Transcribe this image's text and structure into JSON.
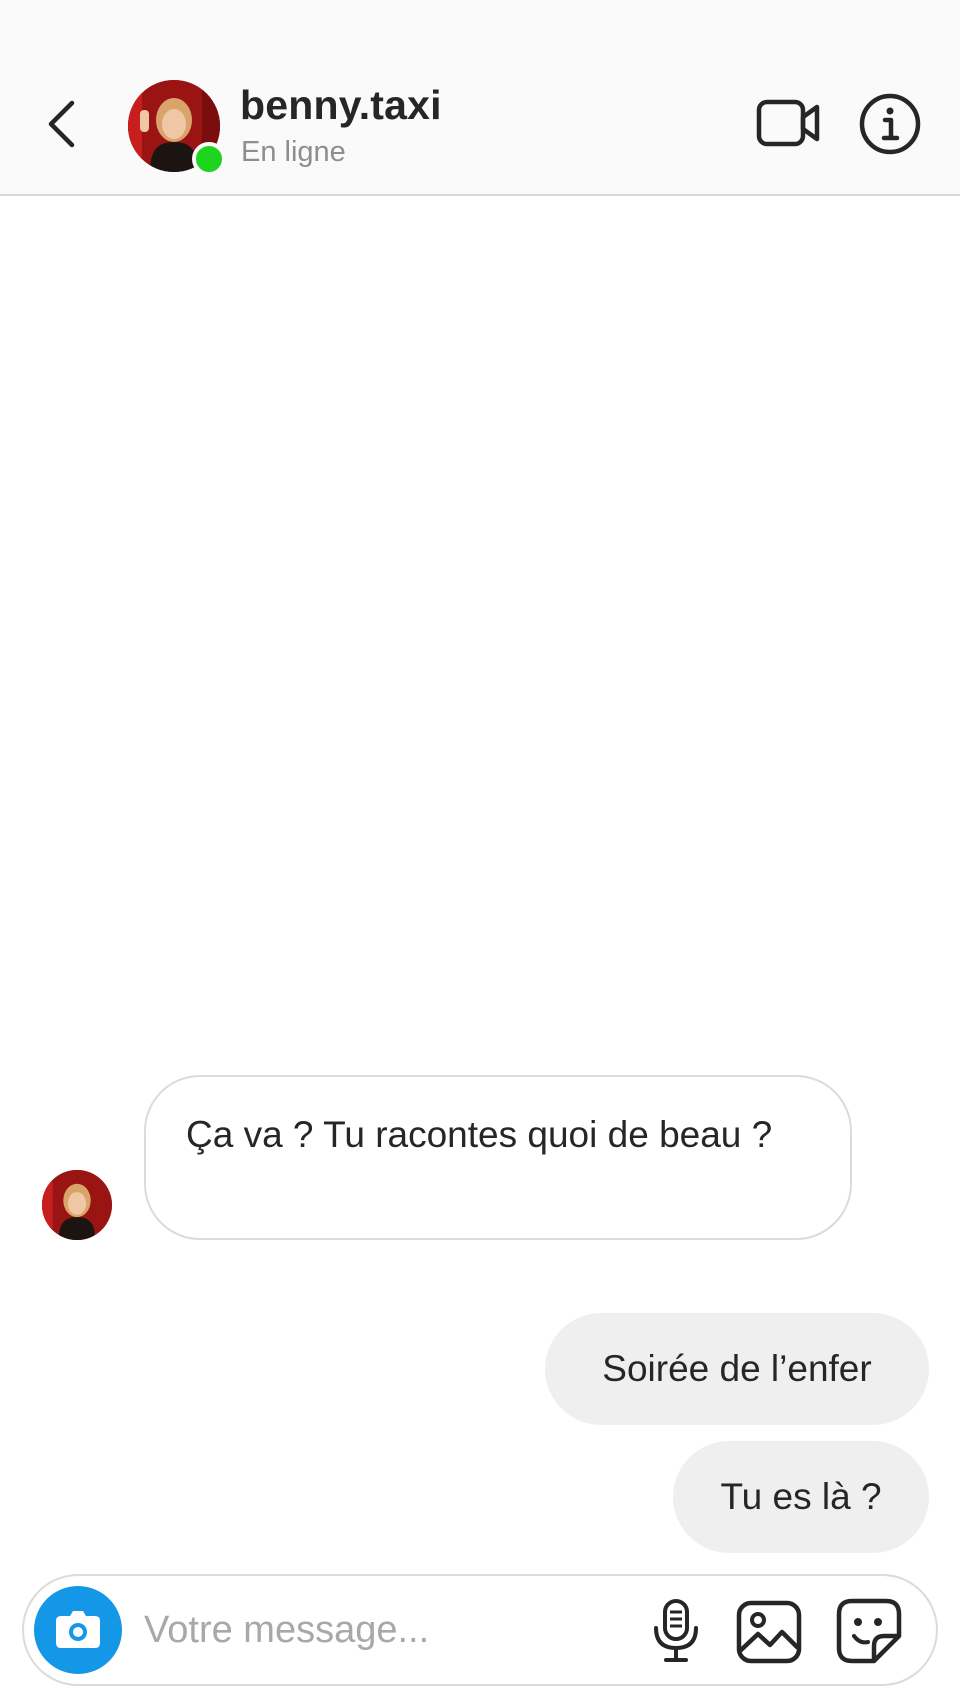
{
  "header": {
    "username": "benny.taxi",
    "status": "En ligne",
    "online_color": "#1fd41f"
  },
  "icons": {
    "back": "chevron-left-icon",
    "video": "video-camera-icon",
    "info": "info-circle-icon",
    "camera": "camera-icon",
    "mic": "microphone-icon",
    "gallery": "image-gallery-icon",
    "sticker": "sticker-icon"
  },
  "messages": [
    {
      "direction": "incoming",
      "text": "Ça va ? Tu racontes quoi de beau ?"
    },
    {
      "direction": "outgoing",
      "text": "Soirée de l’enfer"
    },
    {
      "direction": "outgoing",
      "text": "Tu es là ?"
    }
  ],
  "composer": {
    "placeholder": "Votre message...",
    "value": ""
  },
  "colors": {
    "accent": "#1597e8",
    "outgoing_bubble": "#efefef",
    "incoming_border": "#dbdbdb",
    "secondary_text": "#8e8e8e"
  }
}
